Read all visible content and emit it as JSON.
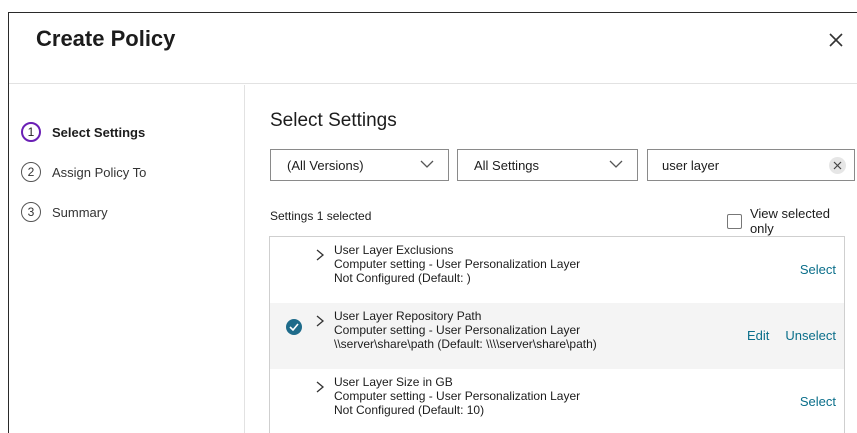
{
  "dialog": {
    "title": "Create Policy",
    "close_icon": "close-icon"
  },
  "steps": [
    {
      "number": "1",
      "label": "Select Settings",
      "active": true
    },
    {
      "number": "2",
      "label": "Assign Policy To",
      "active": false
    },
    {
      "number": "3",
      "label": "Summary",
      "active": false
    }
  ],
  "main": {
    "title": "Select Settings",
    "version_filter": "(All Versions)",
    "category_filter": "All Settings",
    "search_value": "user layer",
    "settings_count": "Settings 1 selected",
    "view_selected_label": "View selected only"
  },
  "settings": [
    {
      "name": "User Layer Exclusions",
      "type": "Computer setting - User Personalization Layer",
      "value": "Not Configured (Default: )",
      "selected": false,
      "actions": [
        "Select"
      ]
    },
    {
      "name": "User Layer Repository Path",
      "type": "Computer setting - User Personalization Layer",
      "value": "\\\\server\\share\\path (Default: \\\\\\\\server\\share\\path)",
      "selected": true,
      "actions": [
        "Edit",
        "Unselect"
      ]
    },
    {
      "name": "User Layer Size in GB",
      "type": "Computer setting - User Personalization Layer",
      "value": "Not Configured (Default: 10)",
      "selected": false,
      "actions": [
        "Select"
      ]
    }
  ],
  "colors": {
    "active_step_ring": "#6a1fb5",
    "link": "#0a6e8a",
    "check": "#1e6b8a"
  }
}
